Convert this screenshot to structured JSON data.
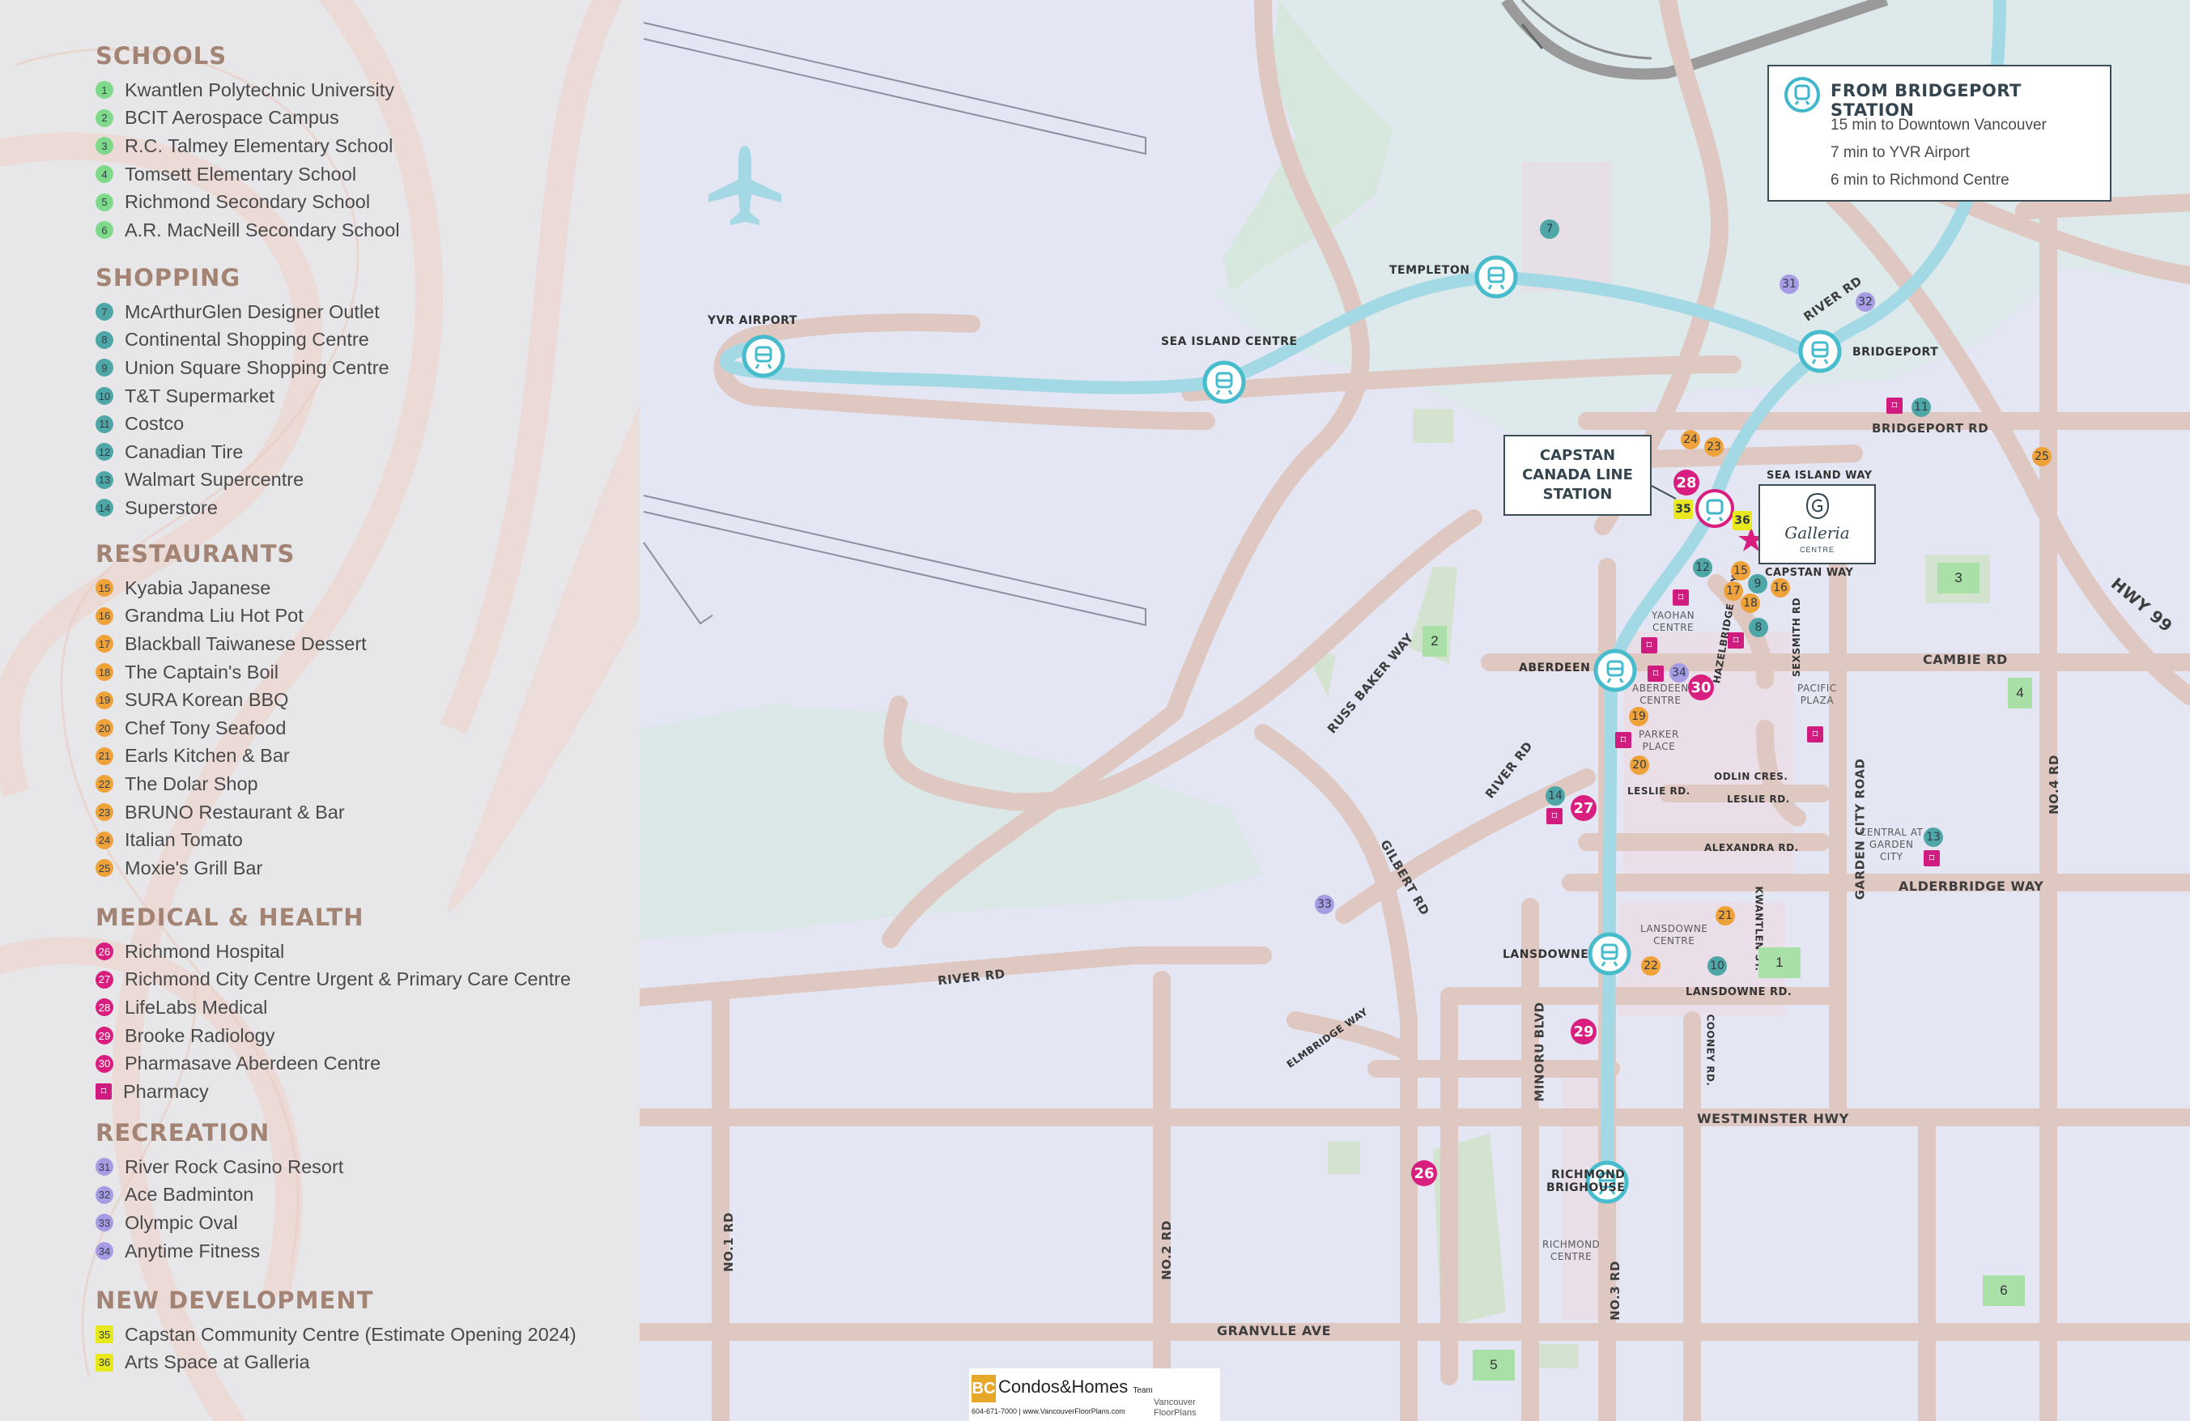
{
  "legend": {
    "sections": [
      {
        "heading": "SCHOOLS",
        "color": "#7ed98a",
        "shape": "circle",
        "items": [
          {
            "num": "1",
            "label": "Kwantlen Polytechnic University"
          },
          {
            "num": "2",
            "label": "BCIT Aerospace Campus"
          },
          {
            "num": "3",
            "label": "R.C. Talmey Elementary School"
          },
          {
            "num": "4",
            "label": "Tomsett Elementary School"
          },
          {
            "num": "5",
            "label": "Richmond Secondary School"
          },
          {
            "num": "6",
            "label": "A.R. MacNeill Secondary School"
          }
        ]
      },
      {
        "heading": "SHOPPING",
        "color": "#4fa6a6",
        "shape": "circle",
        "items": [
          {
            "num": "7",
            "label": "McArthurGlen Designer Outlet"
          },
          {
            "num": "8",
            "label": "Continental Shopping Centre"
          },
          {
            "num": "9",
            "label": "Union Square Shopping Centre"
          },
          {
            "num": "10",
            "label": "T&T Supermarket"
          },
          {
            "num": "11",
            "label": "Costco"
          },
          {
            "num": "12",
            "label": "Canadian Tire"
          },
          {
            "num": "13",
            "label": "Walmart Supercentre"
          },
          {
            "num": "14",
            "label": "Superstore"
          }
        ]
      },
      {
        "heading": "RESTAURANTS",
        "color": "#f0a23a",
        "shape": "circle",
        "items": [
          {
            "num": "15",
            "label": "Kyabia Japanese"
          },
          {
            "num": "16",
            "label": "Grandma Liu Hot Pot"
          },
          {
            "num": "17",
            "label": "Blackball Taiwanese Dessert"
          },
          {
            "num": "18",
            "label": "The Captain's Boil"
          },
          {
            "num": "19",
            "label": "SURA Korean BBQ"
          },
          {
            "num": "20",
            "label": "Chef Tony Seafood"
          },
          {
            "num": "21",
            "label": "Earls Kitchen & Bar"
          },
          {
            "num": "22",
            "label": "The Dolar Shop"
          },
          {
            "num": "23",
            "label": "BRUNO Restaurant & Bar"
          },
          {
            "num": "24",
            "label": "Italian Tomato"
          },
          {
            "num": "25",
            "label": "Moxie's Grill Bar"
          }
        ]
      },
      {
        "heading": "MEDICAL & HEALTH",
        "color": "#d81e7e",
        "shape": "circle",
        "items": [
          {
            "num": "26",
            "label": "Richmond Hospital"
          },
          {
            "num": "27",
            "label": "Richmond City Centre Urgent & Primary Care Centre"
          },
          {
            "num": "28",
            "label": "LifeLabs Medical"
          },
          {
            "num": "29",
            "label": "Brooke Radiology"
          },
          {
            "num": "30",
            "label": "Pharmasave Aberdeen Centre"
          },
          {
            "num": "",
            "label": "Pharmacy",
            "pharmacy": true
          }
        ]
      },
      {
        "heading": "RECREATION",
        "color": "#a79ce3",
        "shape": "circle",
        "items": [
          {
            "num": "31",
            "label": "River Rock Casino Resort"
          },
          {
            "num": "32",
            "label": "Ace Badminton"
          },
          {
            "num": "33",
            "label": "Olympic Oval"
          },
          {
            "num": "34",
            "label": "Anytime Fitness"
          }
        ]
      },
      {
        "heading": "NEW DEVELOPMENT",
        "color": "#e8e81c",
        "shape": "square",
        "items": [
          {
            "num": "35",
            "label": "Capstan Community Centre (Estimate Opening 2024)"
          },
          {
            "num": "36",
            "label": "Arts Space at Galleria"
          }
        ]
      }
    ]
  },
  "info_box": {
    "title": "FROM BRIDGEPORT STATION",
    "lines": [
      "15 min to Downtown Vancouver",
      "7 min to YVR Airport",
      "6 min to Richmond Centre"
    ]
  },
  "capstan_label": "CAPSTAN\nCANADA LINE\nSTATION",
  "galleria": {
    "name": "Galleria",
    "sub": "CENTRE"
  },
  "stations": [
    {
      "name": "YVR AIRPORT"
    },
    {
      "name": "SEA ISLAND CENTRE"
    },
    {
      "name": "TEMPLETON"
    },
    {
      "name": "BRIDGEPORT"
    },
    {
      "name": "ABERDEEN"
    },
    {
      "name": "LANSDOWNE"
    },
    {
      "name": "RICHMOND\nBRIGHOUSE"
    }
  ],
  "roads": {
    "river_rd_north": "RIVER RD",
    "bridgeport_rd": "BRIDGEPORT RD",
    "sea_island_way": "SEA ISLAND WAY",
    "capstan_way": "CAPSTAN WAY",
    "hwy99": "HWY 99",
    "cambie_rd": "CAMBIE RD",
    "russ_baker": "RUSS BAKER WAY",
    "river_rd_mid": "RIVER RD",
    "gilbert": "GILBERT RD",
    "hazelbridge": "HAZELBRIDGE WAY",
    "sexsmith": "SEXSMITH RD",
    "odlin": "ODLIN CRES.",
    "leslie1": "LESLIE RD.",
    "leslie2": "LESLIE RD.",
    "alexandra": "ALEXANDRA RD.",
    "garden_city": "GARDEN CITY ROAD",
    "no4": "NO.4 RD",
    "alderbridge": "ALDERBRIDGE WAY",
    "river_rd_south": "RIVER RD",
    "kwantlen": "KWANTLEN ST.",
    "lansdowne_rd": "LANSDOWNE RD.",
    "elmbridge": "ELMBRIDGE WAY",
    "minoru": "MINORU BLVD",
    "cooney": "COONEY RD.",
    "westminster": "WESTMINSTER HWY",
    "no1": "NO.1 RD",
    "no2": "NO.2 RD",
    "no3": "NO.3 RD",
    "granville": "GRANVLLE AVE"
  },
  "places": {
    "yaohan": "YAOHAN\nCENTRE",
    "aberdeen_centre": "ABERDEEN\nCENTRE",
    "parker": "PARKER\nPLACE",
    "pacific": "PACIFIC\nPLAZA",
    "central": "CENTRAL AT\nGARDEN\nCITY",
    "lansdowne_centre": "LANSDOWNE\nCENTRE",
    "richmond_centre": "RICHMOND\nCENTRE"
  },
  "footer": {
    "bc": "BC",
    "brand": "Condos&Homes",
    "team": "Team",
    "contact": "604-671-7000 | www.VancouverFloorPlans.com",
    "vfp": "Vancouver\nFloorPlans"
  },
  "colors": {
    "skytrain": "#a7dbe6",
    "road": "#e0cac3",
    "water": "#dfeaec",
    "park": "#d6e4d6",
    "legend_heading": "#a38373"
  }
}
